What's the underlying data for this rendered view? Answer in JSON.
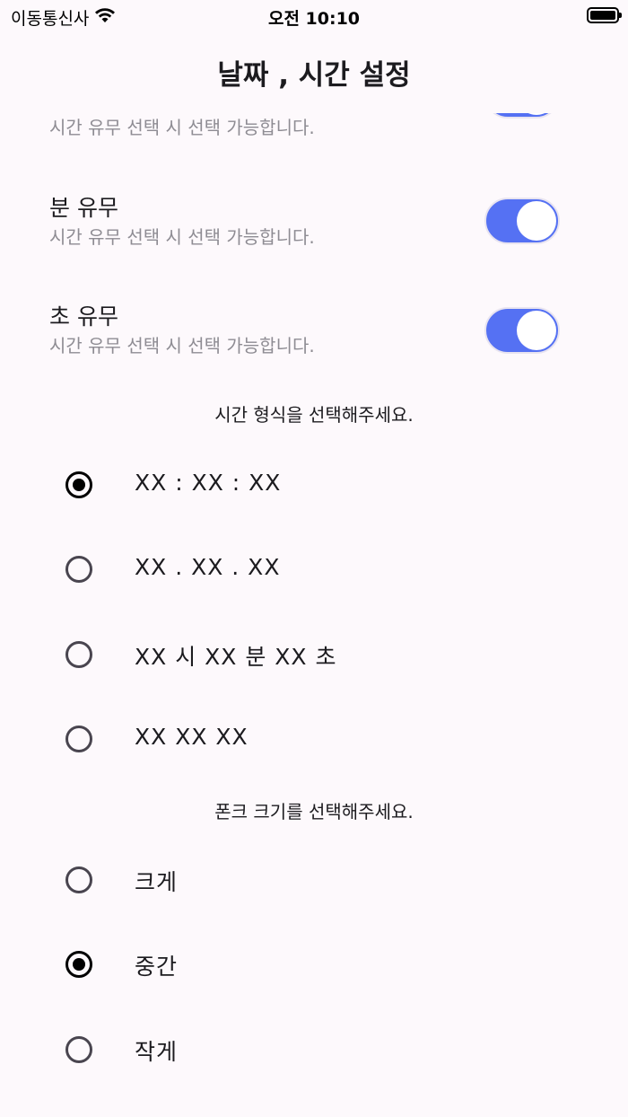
{
  "status_bar": {
    "carrier": "이동통신사",
    "time": "오전 10:10"
  },
  "app_bar": {
    "title": "날짜 , 시간 설정"
  },
  "toggles": [
    {
      "title": "",
      "subtitle": "시간 유무 선택 시 선택 가능합니다.",
      "on": true
    },
    {
      "title": "분 유무",
      "subtitle": "시간 유무 선택 시 선택 가능합니다.",
      "on": true
    },
    {
      "title": "초 유무",
      "subtitle": "시간 유무 선택 시 선택 가능합니다.",
      "on": true
    }
  ],
  "time_format": {
    "label": "시간 형식을 선택해주세요.",
    "options": [
      "XX : XX : XX",
      "XX . XX . XX",
      "XX 시 XX 분 XX 초",
      "XX XX XX"
    ],
    "selected": "XX : XX : XX"
  },
  "font_size": {
    "label": "폰크 크기를 선택해주세요.",
    "options": [
      "크게",
      "중간",
      "작게"
    ],
    "selected": "중간"
  },
  "colors": {
    "switch_on": "#5571f3",
    "background": "#fdf9fc"
  },
  "icons": {
    "wifi": "wifi-icon",
    "battery": "battery-icon"
  }
}
